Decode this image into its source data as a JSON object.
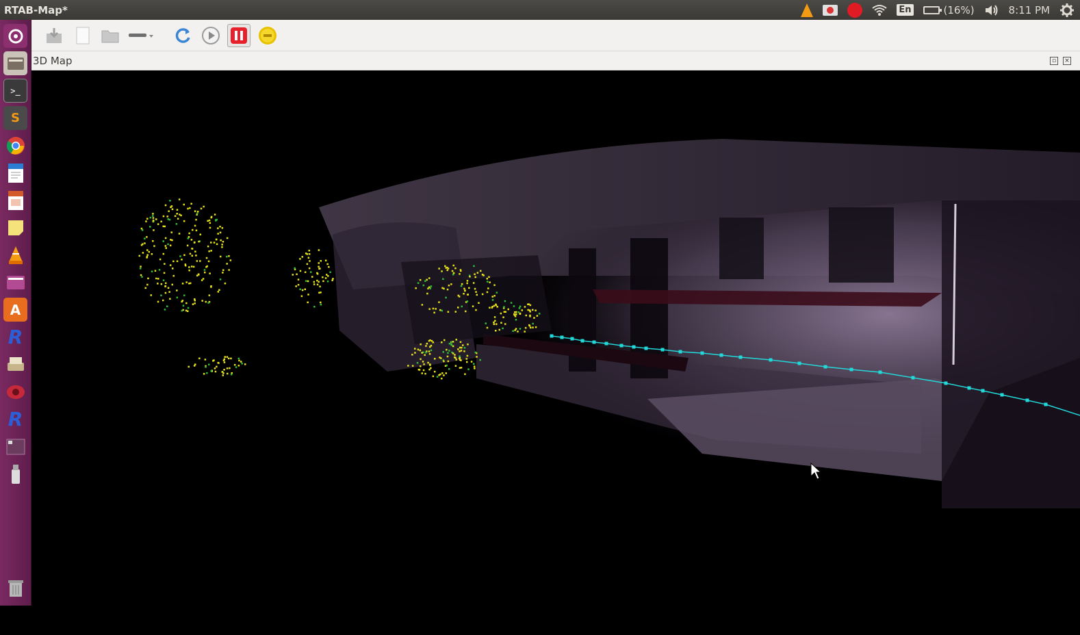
{
  "window": {
    "title": "RTAB-Map*"
  },
  "tray": {
    "language": "En",
    "battery": "(16%)",
    "time": "8:11 PM",
    "icons": [
      "vlc-icon",
      "screen-recorder-icon",
      "record-icon",
      "wifi-icon",
      "keyboard-language-icon",
      "battery-icon",
      "volume-icon",
      "settings-gear-icon"
    ]
  },
  "launcher": {
    "items": [
      "ubuntu-dash-icon",
      "files-icon",
      "terminal-icon",
      "sublime-text-icon",
      "chrome-icon",
      "writer-icon",
      "impress-icon",
      "sticky-notes-icon",
      "vlc-icon",
      "archive-icon",
      "software-center-icon",
      "rtabmap-icon",
      "scanner-icon",
      "screen-recorder-icon",
      "rtabmap-icon-2",
      "workspace-switcher-icon",
      "usb-drive-icon",
      "trash-icon"
    ]
  },
  "toolbar": {
    "buttons": [
      "save-icon",
      "new-icon",
      "open-icon",
      "camera-source-dropdown-icon",
      "refresh-icon",
      "play-icon",
      "pause-icon",
      "stop-icon"
    ],
    "active": "pause-icon"
  },
  "dock": {
    "title": "3D Map"
  },
  "colors": {
    "trajectory": "#22d8d8",
    "features_yellow": "#e6e21a",
    "features_green": "#2fbf3a",
    "cloud_purple": "#8a7590"
  }
}
